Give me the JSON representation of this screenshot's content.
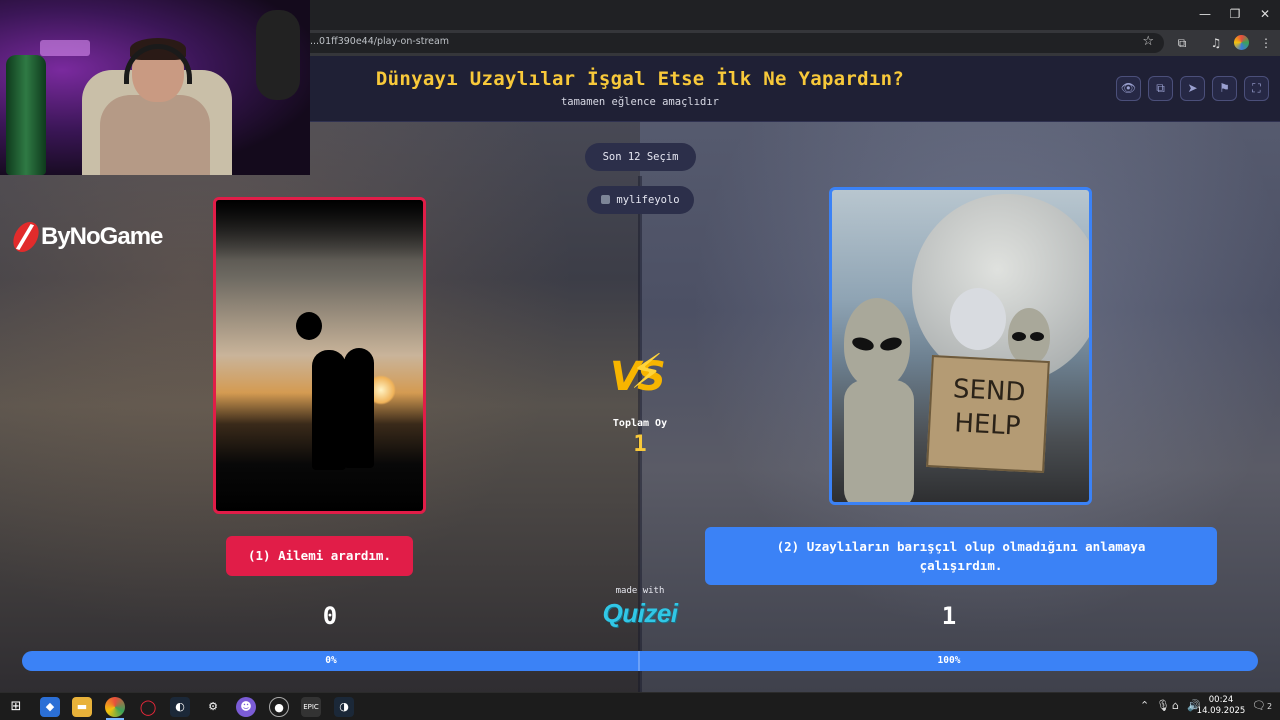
{
  "browser": {
    "url": "...01ff390e44/play-on-stream",
    "window_controls": {
      "minimize": "—",
      "restore": "❐",
      "close": "✕"
    }
  },
  "header": {
    "title": "Dünyayı Uzaylılar İşgal Etse İlk Ne Yapardın?",
    "subtitle": "tamamen eğlence amaçlıdır",
    "buttons": [
      "eye-icon",
      "copy-icon",
      "send-icon",
      "flag-icon",
      "fullscreen-icon"
    ]
  },
  "last_choices": {
    "label": "Son 12 Seçim",
    "user": "mylifeyolo"
  },
  "brand": {
    "name": "ByNoGame"
  },
  "options": {
    "left": {
      "label": "(1) Ailemi arardım.",
      "count": "0",
      "percent_label": "0%",
      "percent": 0
    },
    "right": {
      "label": "(2) Uzaylıların barışçıl olup olmadığını anlamaya çalışırdım.",
      "count": "1",
      "percent_label": "100%",
      "percent": 100
    },
    "sign_text": [
      "SEND",
      "HELP"
    ]
  },
  "vs": {
    "label": "VS",
    "total_votes_label": "Toplam Oy",
    "total_votes": "1"
  },
  "footer": {
    "made_with": "made with",
    "brand": "Quizei"
  },
  "colors": {
    "title": "#f8c93a",
    "left_accent": "#e11d48",
    "right_accent": "#3b82f6",
    "header_bg": "#1f2035"
  },
  "taskbar": {
    "time": "00:24",
    "date": "14.09.2025",
    "notifications": "2"
  }
}
